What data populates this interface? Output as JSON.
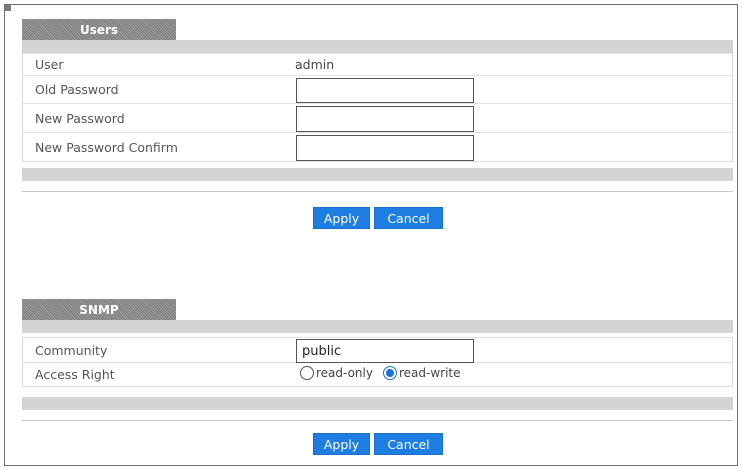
{
  "users": {
    "tab_title": "Users",
    "rows": [
      {
        "label": "User",
        "value": "admin"
      },
      {
        "label": "Old Password",
        "value": ""
      },
      {
        "label": "New Password",
        "value": ""
      },
      {
        "label": "New Password Confirm",
        "value": ""
      }
    ],
    "apply_label": "Apply",
    "cancel_label": "Cancel"
  },
  "snmp": {
    "tab_title": "SNMP",
    "community_label": "Community",
    "community_value": "public",
    "access_label": "Access Right",
    "access_options": [
      {
        "label": "read-only",
        "selected": false
      },
      {
        "label": "read-write",
        "selected": true
      }
    ],
    "apply_label": "Apply",
    "cancel_label": "Cancel"
  },
  "colors": {
    "button": "#1e7de0",
    "tab": "#8a8a8a",
    "bar": "#d4d4d4"
  }
}
